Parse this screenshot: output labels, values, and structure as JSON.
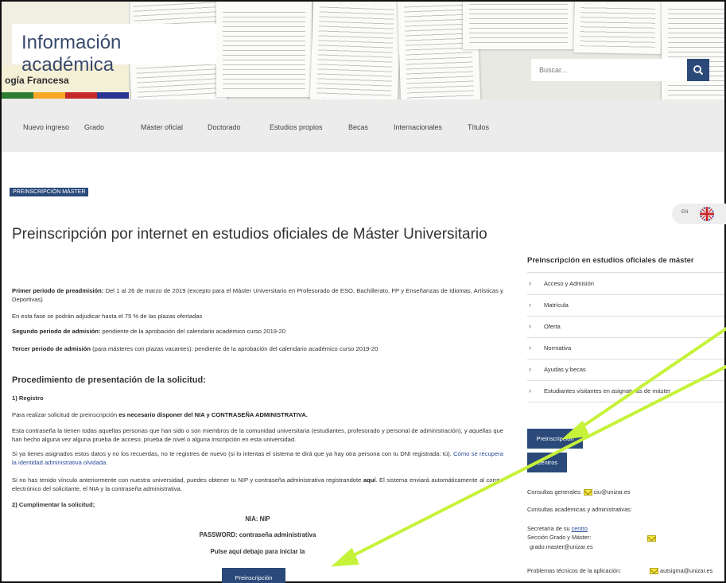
{
  "header": {
    "title": "Información académica",
    "ribbon_text": "ogía Francesa",
    "search_placeholder": "Buscar..."
  },
  "nav": [
    "Nuevo ingreso",
    "Grado",
    "Máster oficial",
    "Doctorado",
    "Estudios propios",
    "Becas",
    "Internacionales",
    "Títulos"
  ],
  "tag": "PREINSCRIPCIÓN MÁSTER",
  "lang": "EN",
  "page_title": "Preinscripción por internet en estudios oficiales de Máster Universitario",
  "content": {
    "p1_bold": "Primer periodo de preadmisión:",
    "p1_text": " Del 1 al 26 de marzo de 2019 (excepto para el Máster Universitario en Profesorado de ESO,  Bachillerato, FP y Enseñanzas de Idiomas, Artísticas y Deportivas)",
    "p2": "En esta fase se podrán adjudicar hasta el 75 % de las plazas ofertadas",
    "p3_bold": "Segundo periodo de admisión:",
    "p3_text": " pendiente de la aprobación del calendario académico curso 2019-20",
    "p4_bold": "Tercer periodo de admisión",
    "p4_text": " (para másteres con plazas vacantes): pendiente de la aprobación del calendario académico curso 2019-20",
    "h_proc": "Procedimiento de presentación de la solicitud:",
    "h_reg": "1) Registro",
    "reg1_text": "Para realizar solicitud de preinscripción ",
    "reg1_bold": "es necesario disponer del NIA y CONTRASEÑA ADMINISTRATIVA.",
    "reg2": "Esta contraseña la tienen todas aquellas personas que han sido o son miembros de la comunidad universitaria (estudiantes, profesorado y personal de administración), y aquellas que han hecho alguna vez alguna prueba de acceso, prueba de nivel o alguna inscripción en esta universidad.",
    "reg3_text": "Si ya tienes asignados estos datos y no los recuerdas, no te registres de nuevo (si lo intentas el sistema te dirá que ya hay otra persona con tu DNI registrada: tú). ",
    "reg3_link": "Cómo se recupera la identidad administrativa olvidada.",
    "reg4_a": "Si no has tenido vínculo anteriormente con nuestra universidad, puedes obtener tu NIP y contraseña administrativa registrandote ",
    "reg4_link": "aquí",
    "reg4_b": ". El sistema enviará automáticamente al correo electrónico del solicitante, el NIA y la contraseña administrativa.",
    "h_fill": "2) Cumplimentar la solicitud;",
    "nia": "NIA: NIP",
    "password": "PASSWORD: contraseña administrativa",
    "pulse": "Pulse aquí debajo para iniciar la",
    "button": "Preinscripción"
  },
  "sidebar": {
    "title": "Preinscripción en estudios oficiales de máster",
    "items": [
      "Acceso y Admisión",
      "Matrícula",
      "Oferta",
      "Normativa",
      "Ayudas y becas",
      "Estudiantes visitantes en asignaturas de máster"
    ],
    "btn_pre": "Preinscripción",
    "btn_centros": "Centros",
    "c1_label": "Consultas generales:",
    "c1_mail": "ciu@unizar.es",
    "c2": "Consultas académicas y administrativas:",
    "c3_text": "Secretaría de su ",
    "c3_link": "centro",
    "c4": "Sección Grado y Máster:",
    "c4_mail": "grado.master@unizar.es",
    "c5_label": "Problemas técnicos de la aplicación:",
    "c5_mail": "autsigma@unizar.es"
  }
}
